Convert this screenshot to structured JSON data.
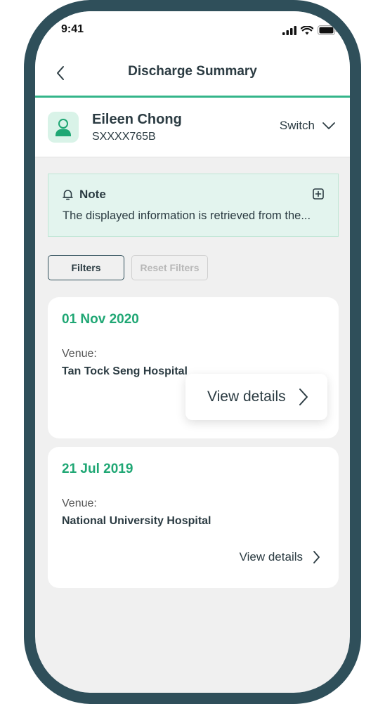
{
  "status_bar": {
    "time": "9:41"
  },
  "header": {
    "title": "Discharge Summary"
  },
  "profile": {
    "name": "Eileen Chong",
    "id": "SXXXX765B",
    "switch_label": "Switch"
  },
  "note": {
    "title": "Note",
    "text": "The displayed information is retrieved from the..."
  },
  "filters": {
    "filters_label": "Filters",
    "reset_label": "Reset Filters"
  },
  "records": [
    {
      "date": "01 Nov 2020",
      "venue_label": "Venue:",
      "venue": "Tan Tock Seng Hospital",
      "action": "View details"
    },
    {
      "date": "21 Jul 2019",
      "venue_label": "Venue:",
      "venue": "National University Hospital",
      "action": "View details"
    }
  ],
  "colors": {
    "frame": "#2f4f5a",
    "accent_green": "#1fa774",
    "note_bg": "#e3f4ee",
    "screen_bg": "#f0f0f0"
  },
  "icons": {
    "back": "chevron-left-icon",
    "avatar": "user-icon",
    "switch": "chevron-down-icon",
    "note": "bell-icon",
    "expand": "plus-square-icon",
    "details": "chevron-right-icon"
  }
}
